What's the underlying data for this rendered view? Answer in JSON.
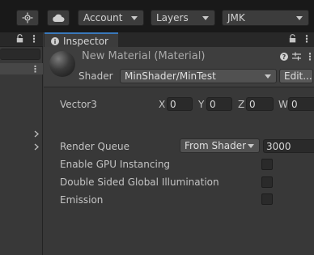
{
  "toolbar": {
    "account_label": "Account",
    "layers_label": "Layers",
    "layout_label": "JMK"
  },
  "inspector": {
    "tab_label": "Inspector",
    "material_title": "New Material (Material)",
    "shader_label": "Shader",
    "shader_value": "MinShader/MinTest",
    "edit_label": "Edit...",
    "vector_label": "Vector3",
    "vector": {
      "x_label": "X",
      "x_value": "0",
      "y_label": "Y",
      "y_value": "0",
      "z_label": "Z",
      "z_value": "0",
      "w_label": "W",
      "w_value": "0"
    },
    "render_queue_label": "Render Queue",
    "render_queue_mode": "From Shader",
    "render_queue_value": "3000",
    "gpu_instancing_label": "Enable GPU Instancing",
    "double_sided_gi_label": "Double Sided Global Illumination",
    "emission_label": "Emission"
  }
}
